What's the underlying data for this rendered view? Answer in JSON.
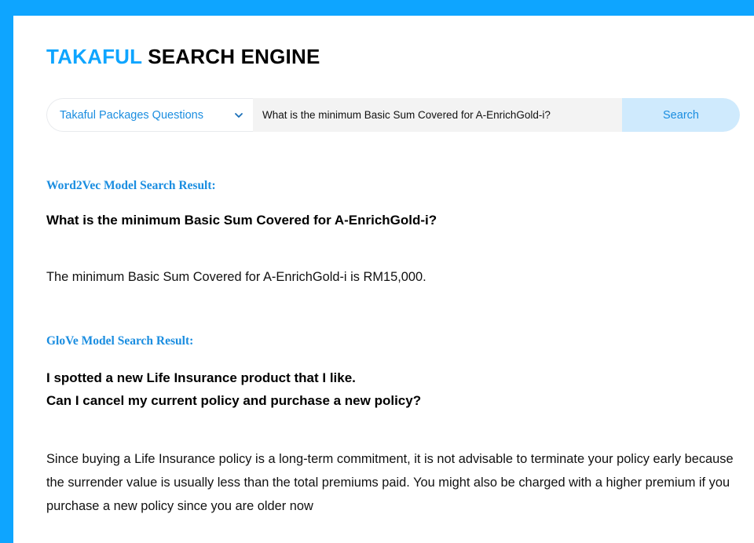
{
  "header": {
    "title_accent": "TAKAFUL",
    "title_rest": " SEARCH ENGINE"
  },
  "search": {
    "category_selected": "Takaful Packages Questions",
    "query": "What is the minimum Basic Sum Covered for A-EnrichGold-i?",
    "button_label": "Search"
  },
  "results": {
    "word2vec": {
      "heading": "Word2Vec Model Search Result:",
      "question": "What is the minimum Basic Sum Covered for A-EnrichGold-i?",
      "answer": "The minimum Basic Sum Covered for A-EnrichGold-i is RM15,000."
    },
    "glove": {
      "heading": "GloVe Model Search Result:",
      "question_line1": "I spotted a new Life Insurance product that I like.",
      "question_line2": "Can I cancel my current policy and purchase a new policy?",
      "answer": "Since buying a Life Insurance policy is a long-term commitment, it is not advisable to terminate your policy early because the surrender value is usually less than the total premiums paid. You might also be charged with a higher premium if you purchase a new policy since you are older now"
    }
  },
  "colors": {
    "background_blue": "#0ea5ff",
    "accent_blue": "#1a8de0",
    "search_button_bg": "#cfeafd"
  }
}
